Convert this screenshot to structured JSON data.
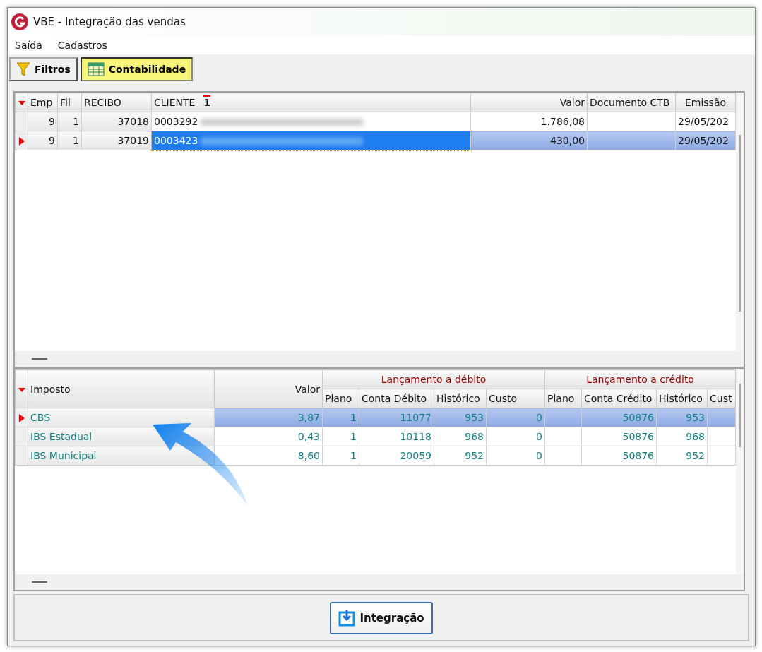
{
  "window": {
    "title": "VBE - Integração das vendas"
  },
  "menu": [
    "Saída",
    "Cadastros"
  ],
  "toolbar": [
    {
      "label": "Filtros",
      "kind": "filter",
      "selected": false
    },
    {
      "label": "Contabilidade",
      "kind": "table",
      "selected": true
    }
  ],
  "receipts": {
    "columns": [
      "Emp",
      "Fil",
      "RECIBO",
      "CLIENTE",
      "Valor",
      "Documento CTB",
      "Emissão"
    ],
    "sort_mark": "1",
    "rows": [
      {
        "emp": "9",
        "fil": "1",
        "recibo": "37018",
        "cliente": "0003292",
        "valor": "1.786,08",
        "documento": "",
        "emissao": "29/05/202",
        "selected": false
      },
      {
        "emp": "9",
        "fil": "1",
        "recibo": "37019",
        "cliente": "0003423",
        "valor": "430,00",
        "documento": "",
        "emissao": "29/05/202",
        "selected": true
      }
    ]
  },
  "taxes": {
    "columns": [
      "Imposto",
      "Valor"
    ],
    "groups": [
      {
        "title": "Lançamento a débito",
        "columns": [
          "Plano",
          "Conta Débito",
          "Histórico",
          "Custo"
        ]
      },
      {
        "title": "Lançamento a crédito",
        "columns": [
          "Plano",
          "Conta Crédito",
          "Histórico",
          "Cust"
        ]
      }
    ],
    "rows": [
      {
        "cells": [
          "CBS",
          "3,87",
          "1",
          "11077",
          "953",
          "0",
          "",
          "50876",
          "953",
          ""
        ],
        "selected": true
      },
      {
        "cells": [
          "IBS Estadual",
          "0,43",
          "1",
          "10118",
          "968",
          "0",
          "",
          "50876",
          "968",
          ""
        ],
        "selected": false
      },
      {
        "cells": [
          "IBS Municipal",
          "8,60",
          "1",
          "20059",
          "952",
          "0",
          "",
          "50876",
          "952",
          ""
        ],
        "selected": false
      }
    ]
  },
  "buttons": [
    {
      "label": "Integração"
    }
  ]
}
